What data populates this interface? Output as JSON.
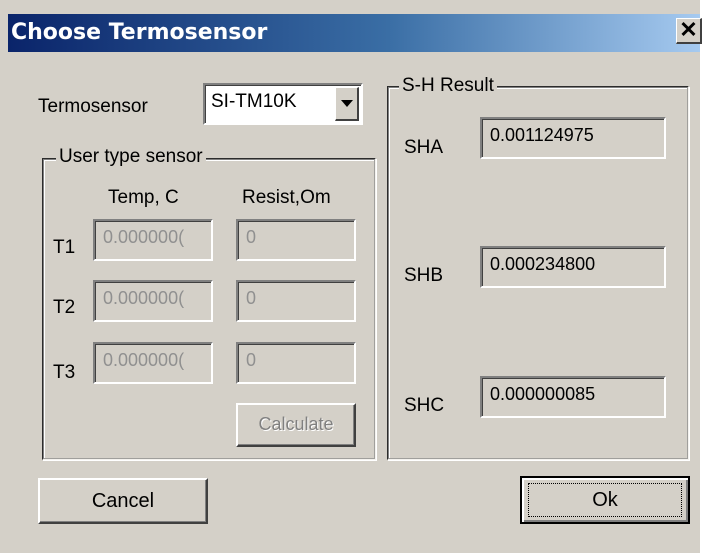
{
  "window": {
    "title": "Choose Termosensor",
    "close_glyph": "✕"
  },
  "termosensor": {
    "label": "Termosensor",
    "selected": "SI-TM10K"
  },
  "user_type_group": {
    "legend": "User type sensor",
    "col_temp": "Temp, C",
    "col_resist": "Resist,Om",
    "rows": [
      {
        "label": "T1",
        "temp": "0.000000(",
        "resist": "0"
      },
      {
        "label": "T2",
        "temp": "0.000000(",
        "resist": "0"
      },
      {
        "label": "T3",
        "temp": "0.000000(",
        "resist": "0"
      }
    ],
    "calculate_label": "Calculate"
  },
  "result_group": {
    "legend": "S-H Result",
    "sha_label": "SHA",
    "sha_value": "0.001124975",
    "shb_label": "SHB",
    "shb_value": "0.000234800",
    "shc_label": "SHC",
    "shc_value": "0.000000085"
  },
  "buttons": {
    "cancel": "Cancel",
    "ok": "Ok"
  }
}
